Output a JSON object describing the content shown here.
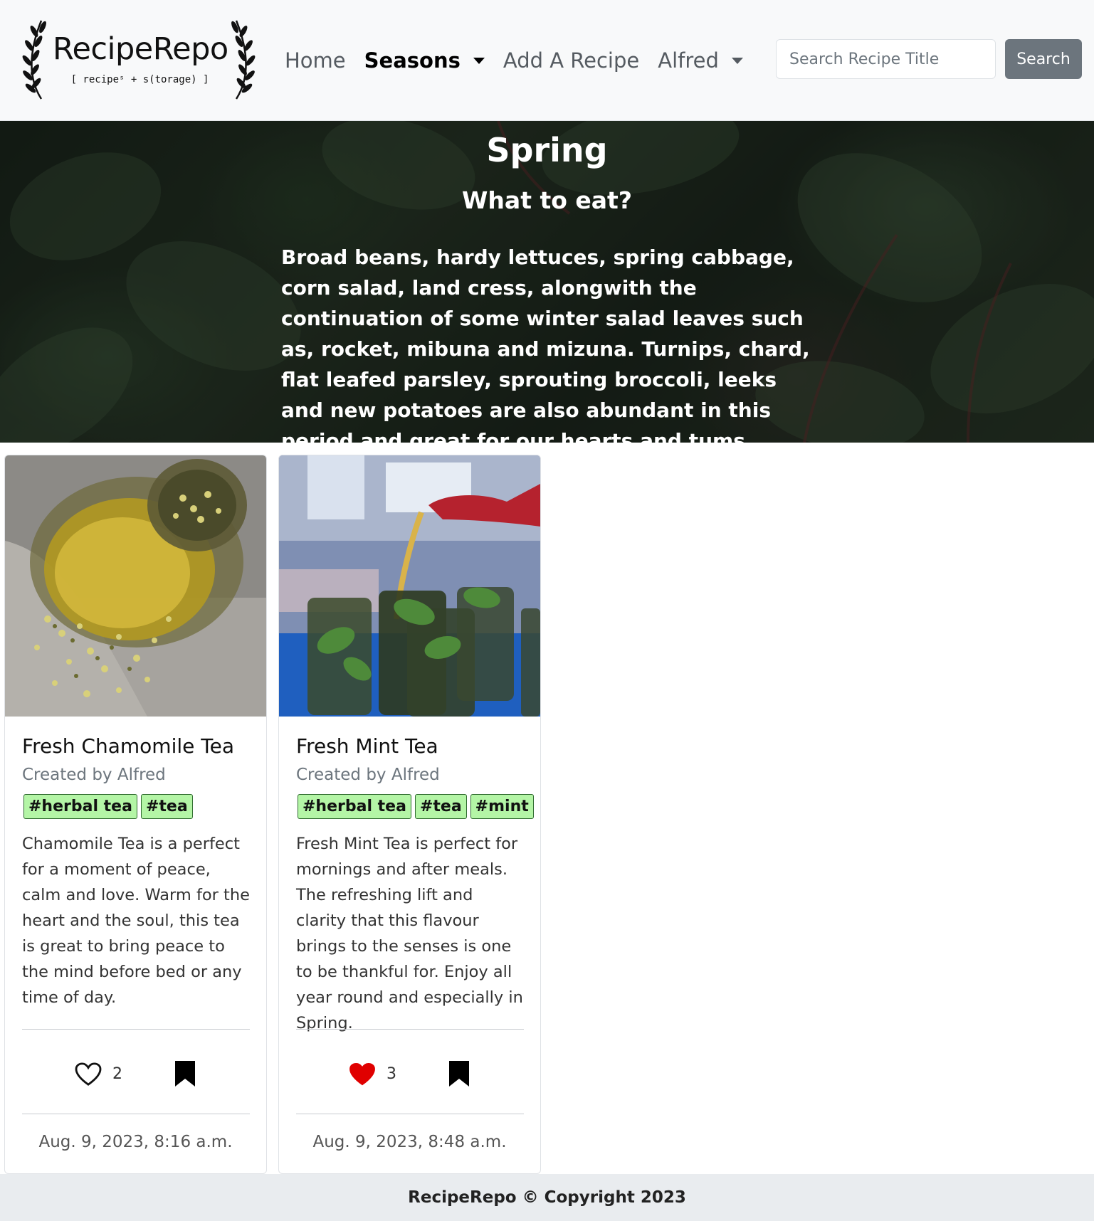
{
  "brand": {
    "name": "RecipeRepo",
    "tagline": "[ recipeˢ + s(torage) ]"
  },
  "nav": {
    "home": "Home",
    "seasons": "Seasons",
    "add_recipe": "Add A Recipe",
    "user": "Alfred"
  },
  "search": {
    "placeholder": "Search Recipe Title",
    "button": "Search"
  },
  "hero": {
    "title": "Spring",
    "subtitle": "What to eat?",
    "text": "Broad beans, hardy lettuces, spring cabbage, corn salad, land cress, alongwith the continuation of some winter salad leaves such as, rocket, mibuna and mizuna. Turnips, chard, flat leafed parsley, sprouting broccoli, leeks and new potatoes are also abundant in this period and great for our hearts and tums."
  },
  "recipes": [
    {
      "title": "Fresh Chamomile Tea",
      "author": "Created by Alfred",
      "tags": [
        "#herbal tea",
        "#tea"
      ],
      "description": "Chamomile Tea is a perfect for a moment of peace, calm and love. Warm for the heart and the soul, this tea is great to bring peace to the mind before bed or any time of day.",
      "likes": "2",
      "liked": false,
      "date": "Aug. 9, 2023, 8:16 a.m."
    },
    {
      "title": "Fresh Mint Tea",
      "author": "Created by Alfred",
      "tags": [
        "#herbal tea",
        "#tea",
        "#mint"
      ],
      "description": "Fresh Mint Tea is perfect for mornings and after meals. The refreshing lift and clarity that this flavour brings to the senses is one to be thankful for. Enjoy all year round and especially in Spring.",
      "likes": "3",
      "liked": true,
      "date": "Aug. 9, 2023, 8:48 a.m."
    }
  ],
  "footer": {
    "text": "RecipeRepo © Copyright 2023"
  },
  "colors": {
    "tag_bg": "#b4f5a6",
    "liked_heart": "#e00000",
    "search_button": "#6c757d",
    "navbar_bg": "#f8f9fa"
  }
}
